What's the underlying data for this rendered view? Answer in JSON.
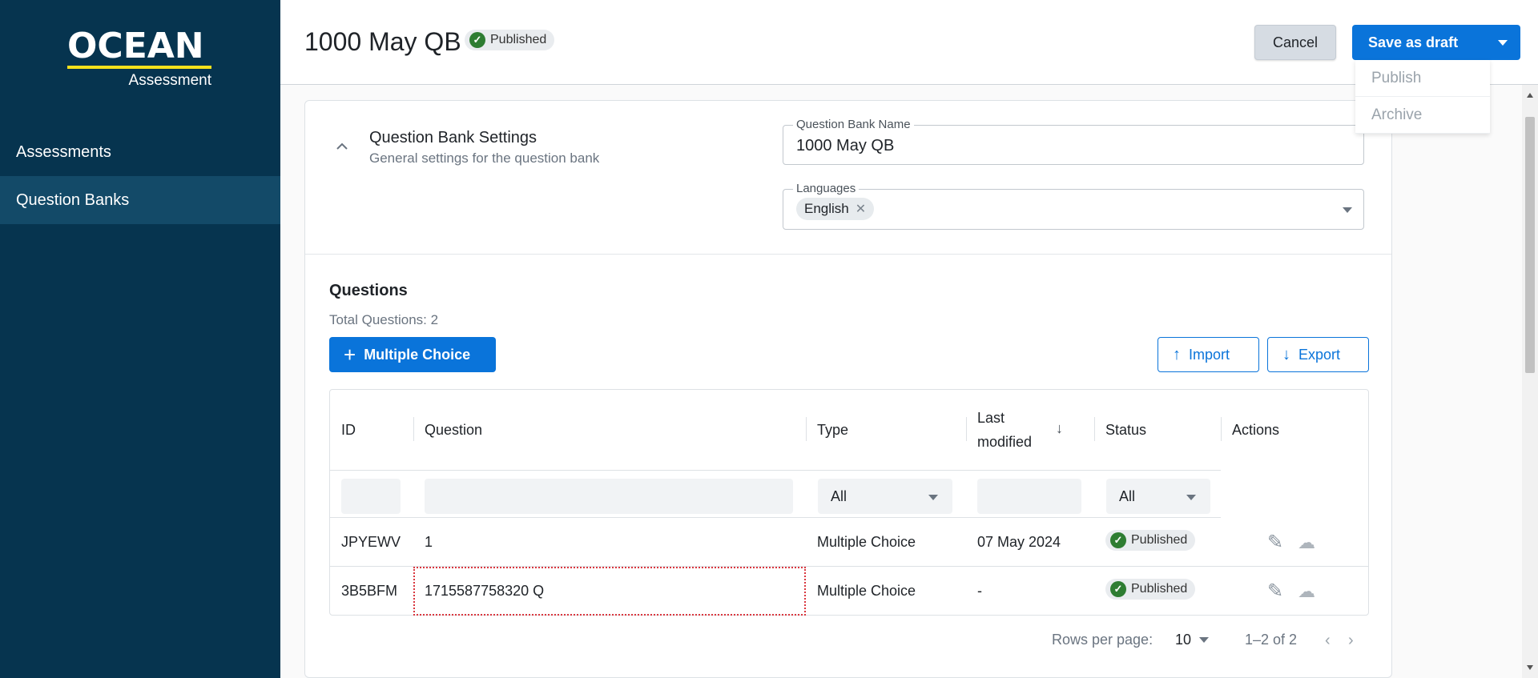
{
  "sidebar": {
    "logo": {
      "brand": "OCEAN",
      "sub": "Assessment"
    },
    "items": [
      {
        "label": "Assessments"
      },
      {
        "label": "Question Banks"
      }
    ]
  },
  "header": {
    "title": "1000 May QB",
    "status": "Published",
    "cancel_label": "Cancel",
    "save_label": "Save as draft"
  },
  "save_menu": {
    "items": [
      "Publish",
      "Archive"
    ]
  },
  "settings": {
    "title": "Question Bank Settings",
    "subtitle": "General settings for the question bank",
    "name_label": "Question Bank Name",
    "name_value": "1000 May QB",
    "languages_label": "Languages",
    "languages": [
      "English"
    ]
  },
  "questions": {
    "title": "Questions",
    "total": "Total Questions: 2",
    "add_label": "Multiple Choice",
    "import_label": "Import",
    "export_label": "Export",
    "columns": [
      "ID",
      "Question",
      "Type",
      "Last modified",
      "Status",
      "Actions"
    ],
    "filters": {
      "type": "All",
      "status": "All"
    },
    "rows": [
      {
        "id": "JPYEWV",
        "question": "1",
        "type": "Multiple Choice",
        "modified": "07 May 2024",
        "status": "Published"
      },
      {
        "id": "3B5BFM",
        "question": "1715587758320 Q",
        "type": "Multiple Choice",
        "modified": "-",
        "status": "Published"
      }
    ]
  },
  "pagination": {
    "rows_label": "Rows per page:",
    "rows_value": "10",
    "range": "1–2 of 2"
  },
  "colors": {
    "sidebar_bg": "#06344f",
    "sidebar_active": "#134a68",
    "primary": "#0a74da",
    "logo_underline": "#f5e11c",
    "status_green": "#2e7d32"
  }
}
